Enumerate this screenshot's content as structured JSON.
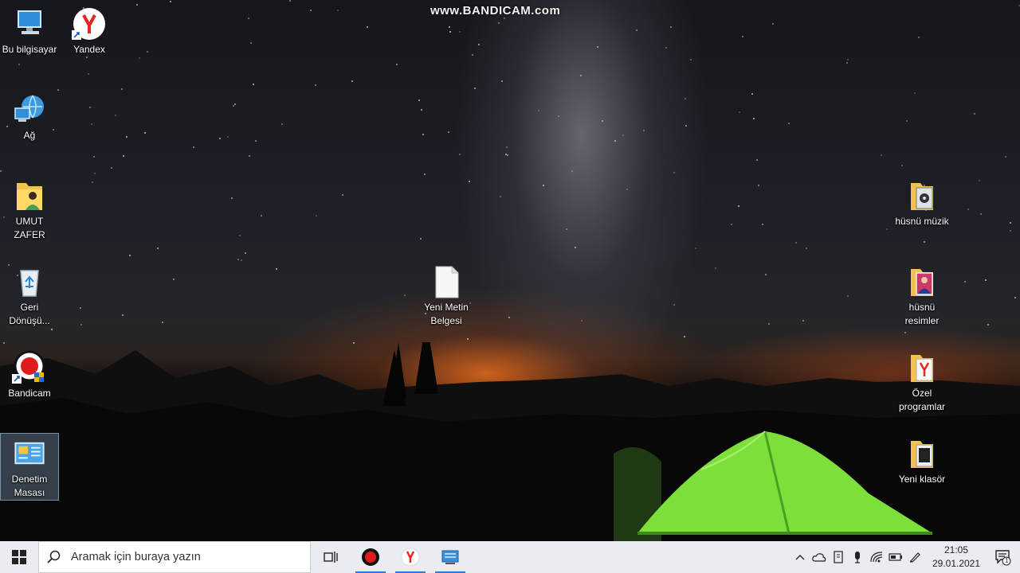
{
  "watermark": "www.BANDICAM.com",
  "desktop_icons_left": [
    {
      "name": "this-pc",
      "label": "Bu bilgisayar"
    },
    {
      "name": "yandex",
      "label": "Yandex"
    },
    {
      "name": "network",
      "label": "Ağ"
    },
    {
      "name": "user-folder",
      "label": "UMUT ZAFER"
    },
    {
      "name": "recycle-bin",
      "label": "Geri Dönüşü..."
    },
    {
      "name": "bandicam",
      "label": "Bandicam"
    },
    {
      "name": "control-panel",
      "label": "Denetim Masası"
    }
  ],
  "desktop_icons_center": [
    {
      "name": "new-text-document",
      "label": "Yeni Metin Belgesi"
    }
  ],
  "desktop_icons_right": [
    {
      "name": "husnu-muzik",
      "label": "hüsnü müzik"
    },
    {
      "name": "husnu-resimler",
      "label": "hüsnü resimler"
    },
    {
      "name": "ozel-programlar",
      "label": "Özel programlar"
    },
    {
      "name": "yeni-klasor",
      "label": "Yeni klasör"
    }
  ],
  "taskbar": {
    "search_placeholder": "Aramak için buraya yazın",
    "pinned": [
      "task-view",
      "bandicam",
      "yandex-browser",
      "control-panel"
    ],
    "clock_time": "21:05",
    "clock_date": "29.01.2021",
    "notification_count": "1"
  },
  "colors": {
    "taskbar_bg": "#e9edf1",
    "accent": "#2d7fd6",
    "tent_green": "#7de03a",
    "horizon_orange": "#e86a1e"
  }
}
